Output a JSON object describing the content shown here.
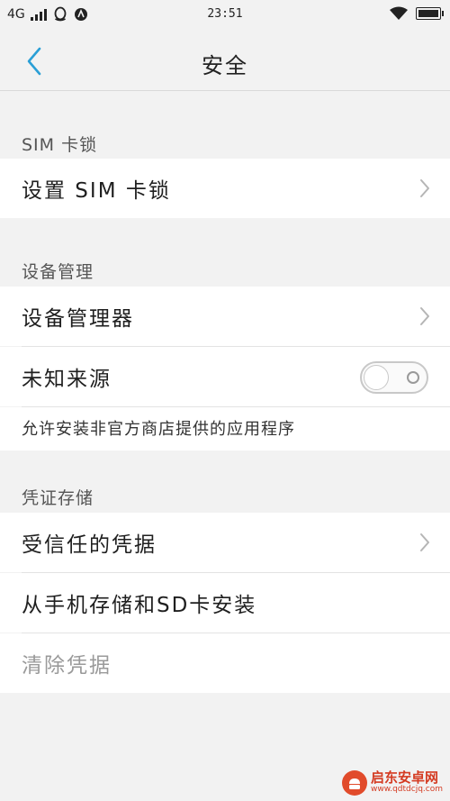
{
  "status_bar": {
    "network": "4G",
    "time": "23:51"
  },
  "header": {
    "title": "安全"
  },
  "sections": {
    "sim": {
      "header": "SIM 卡锁",
      "items": [
        {
          "label": "设置 SIM 卡锁"
        }
      ]
    },
    "device": {
      "header": "设备管理",
      "items": [
        {
          "label": "设备管理器"
        },
        {
          "label": "未知来源",
          "toggle": "off"
        }
      ],
      "description": "允许安装非官方商店提供的应用程序"
    },
    "credentials": {
      "header": "凭证存储",
      "items": [
        {
          "label": "受信任的凭据"
        },
        {
          "label": "从手机存储和SD卡安装"
        },
        {
          "label": "清除凭据",
          "disabled": true
        }
      ]
    }
  },
  "watermark": {
    "name": "启东安卓网",
    "url": "www.qdtdcjq.com"
  },
  "colors": {
    "accent": "#2a9fd6",
    "background": "#f2f2f2",
    "row_background": "#ffffff",
    "disabled_text": "#9a9a9a"
  }
}
